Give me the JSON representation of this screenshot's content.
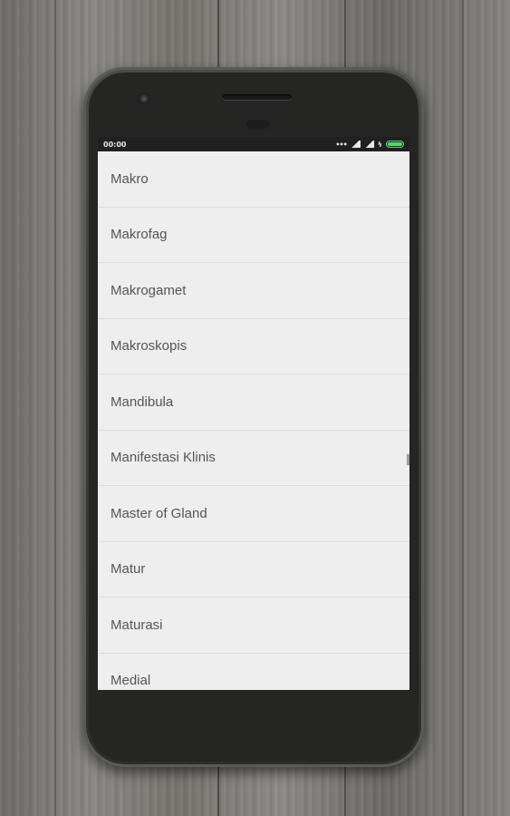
{
  "status_bar": {
    "time": "00:00",
    "icons": [
      "dots-icon",
      "signal-icon",
      "signal-icon",
      "charging-icon",
      "battery-icon"
    ]
  },
  "terms": [
    "Makro",
    "Makrofag",
    "Makrogamet",
    "Makroskopis",
    "Mandibula",
    "Manifestasi Klinis",
    "Master of Gland",
    "Matur",
    "Maturasi",
    "Medial"
  ],
  "colors": {
    "list_background": "#eeeeee",
    "list_text": "#555555",
    "divider": "#dcdcdc",
    "status_bar": "#202020",
    "battery": "#4cd964"
  }
}
